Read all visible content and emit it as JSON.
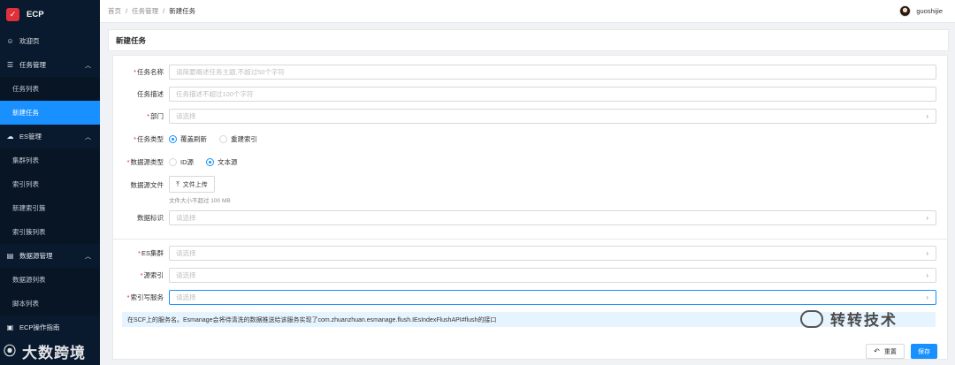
{
  "app": {
    "title": "ECP"
  },
  "sidebar": {
    "items": [
      {
        "label": "欢迎页",
        "icon": "smile-icon"
      },
      {
        "label": "任务管理",
        "icon": "list-icon"
      },
      {
        "label": "任务列表"
      },
      {
        "label": "新建任务"
      },
      {
        "label": "ES管理",
        "icon": "cloud-icon"
      },
      {
        "label": "集群列表"
      },
      {
        "label": "索引列表"
      },
      {
        "label": "新建索引簇"
      },
      {
        "label": "索引簇列表"
      },
      {
        "label": "数据源管理",
        "icon": "database-icon"
      },
      {
        "label": "数据源列表"
      },
      {
        "label": "脚本列表"
      },
      {
        "label": "ECP操作指南",
        "icon": "book-icon"
      }
    ]
  },
  "header": {
    "breadcrumb": [
      "首页",
      "任务管理",
      "新建任务"
    ],
    "username": "guoshijie"
  },
  "page": {
    "title": "新建任务"
  },
  "form": {
    "task_name": {
      "label": "任务名称",
      "placeholder": "请简要概述任务主题,不超过50个字符"
    },
    "task_desc": {
      "label": "任务描述",
      "placeholder": "任务描述不超过100个字符"
    },
    "department": {
      "label": "部门",
      "placeholder": "请选择"
    },
    "task_type": {
      "label": "任务类型",
      "options": [
        "覆盖刷新",
        "重建索引"
      ],
      "selected": "覆盖刷新"
    },
    "source_type": {
      "label": "数据源类型",
      "options": [
        "ID源",
        "文本源"
      ],
      "selected": "文本源"
    },
    "source_file": {
      "label": "数据源文件",
      "button": "文件上传",
      "hint": "文件大小不超过 100 MB"
    },
    "data_tag": {
      "label": "数据标识",
      "placeholder": "请选择"
    },
    "es_cluster": {
      "label": "ES集群",
      "placeholder": "请选择"
    },
    "source_index": {
      "label": "源索引",
      "placeholder": "请选择"
    },
    "index_service": {
      "label": "索引写服务",
      "placeholder": "请选择"
    },
    "notice": "在SCF上的服务名。Esmanage会将待清洗的数据推送给该服务实现了com.zhuanzhuan.esmanage.flush.IEsIndexFlushAPI#flush的接口"
  },
  "actions": {
    "reset": "重置",
    "save": "保存"
  },
  "watermarks": {
    "left": "大数跨境",
    "right": "转转技术"
  },
  "colors": {
    "sidebar": "#0a1a2e",
    "accent": "#1890ff",
    "required": "#f5222d",
    "brand": "#e0313a"
  }
}
